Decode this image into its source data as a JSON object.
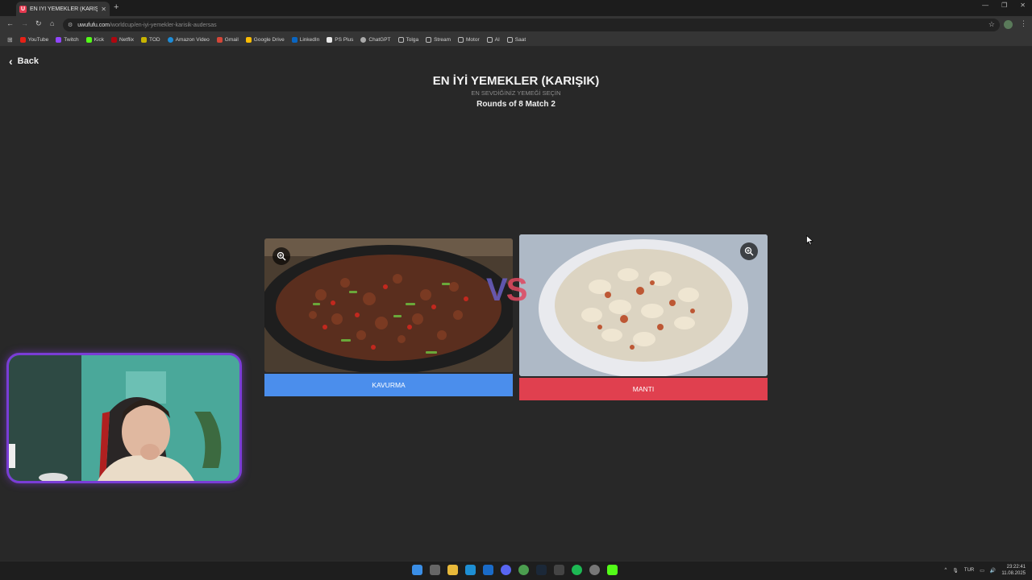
{
  "browser": {
    "tab_title": "EN İYİ YEMEKLER (KARIŞIK) | Uw",
    "tab_favicon_letter": "U",
    "url_host": "uwufufu.com",
    "url_path": "/worldcup/en-iyi-yemekler-karisik-audersas",
    "bookmarks": [
      "YouTube",
      "Twitch",
      "Kick",
      "Netflix",
      "TOD",
      "Amazon Video",
      "Gmail",
      "Google Drive",
      "LinkedIn",
      "PS Plus",
      "ChatGPT",
      "Tolga",
      "Stream",
      "Motor",
      "AI",
      "Saat"
    ],
    "colors": {
      "accent_red": "#e53950"
    }
  },
  "page": {
    "back_label": "Back",
    "title": "EN İYİ YEMEKLER (KARIŞIK)",
    "subtitle": "EN SEVDİĞİNİZ YEMEĞİ SEÇİN",
    "round_label": "Rounds of 8 Match 2",
    "vs_v": "V",
    "vs_s": "S",
    "left_choice": {
      "label": "KAVURMA",
      "color": "#4b8eec"
    },
    "right_choice": {
      "label": "MANTI",
      "color": "#e0404f"
    }
  },
  "taskbar": {
    "language": "TUR",
    "time": "23:22:41",
    "date": "11.08.2025"
  }
}
